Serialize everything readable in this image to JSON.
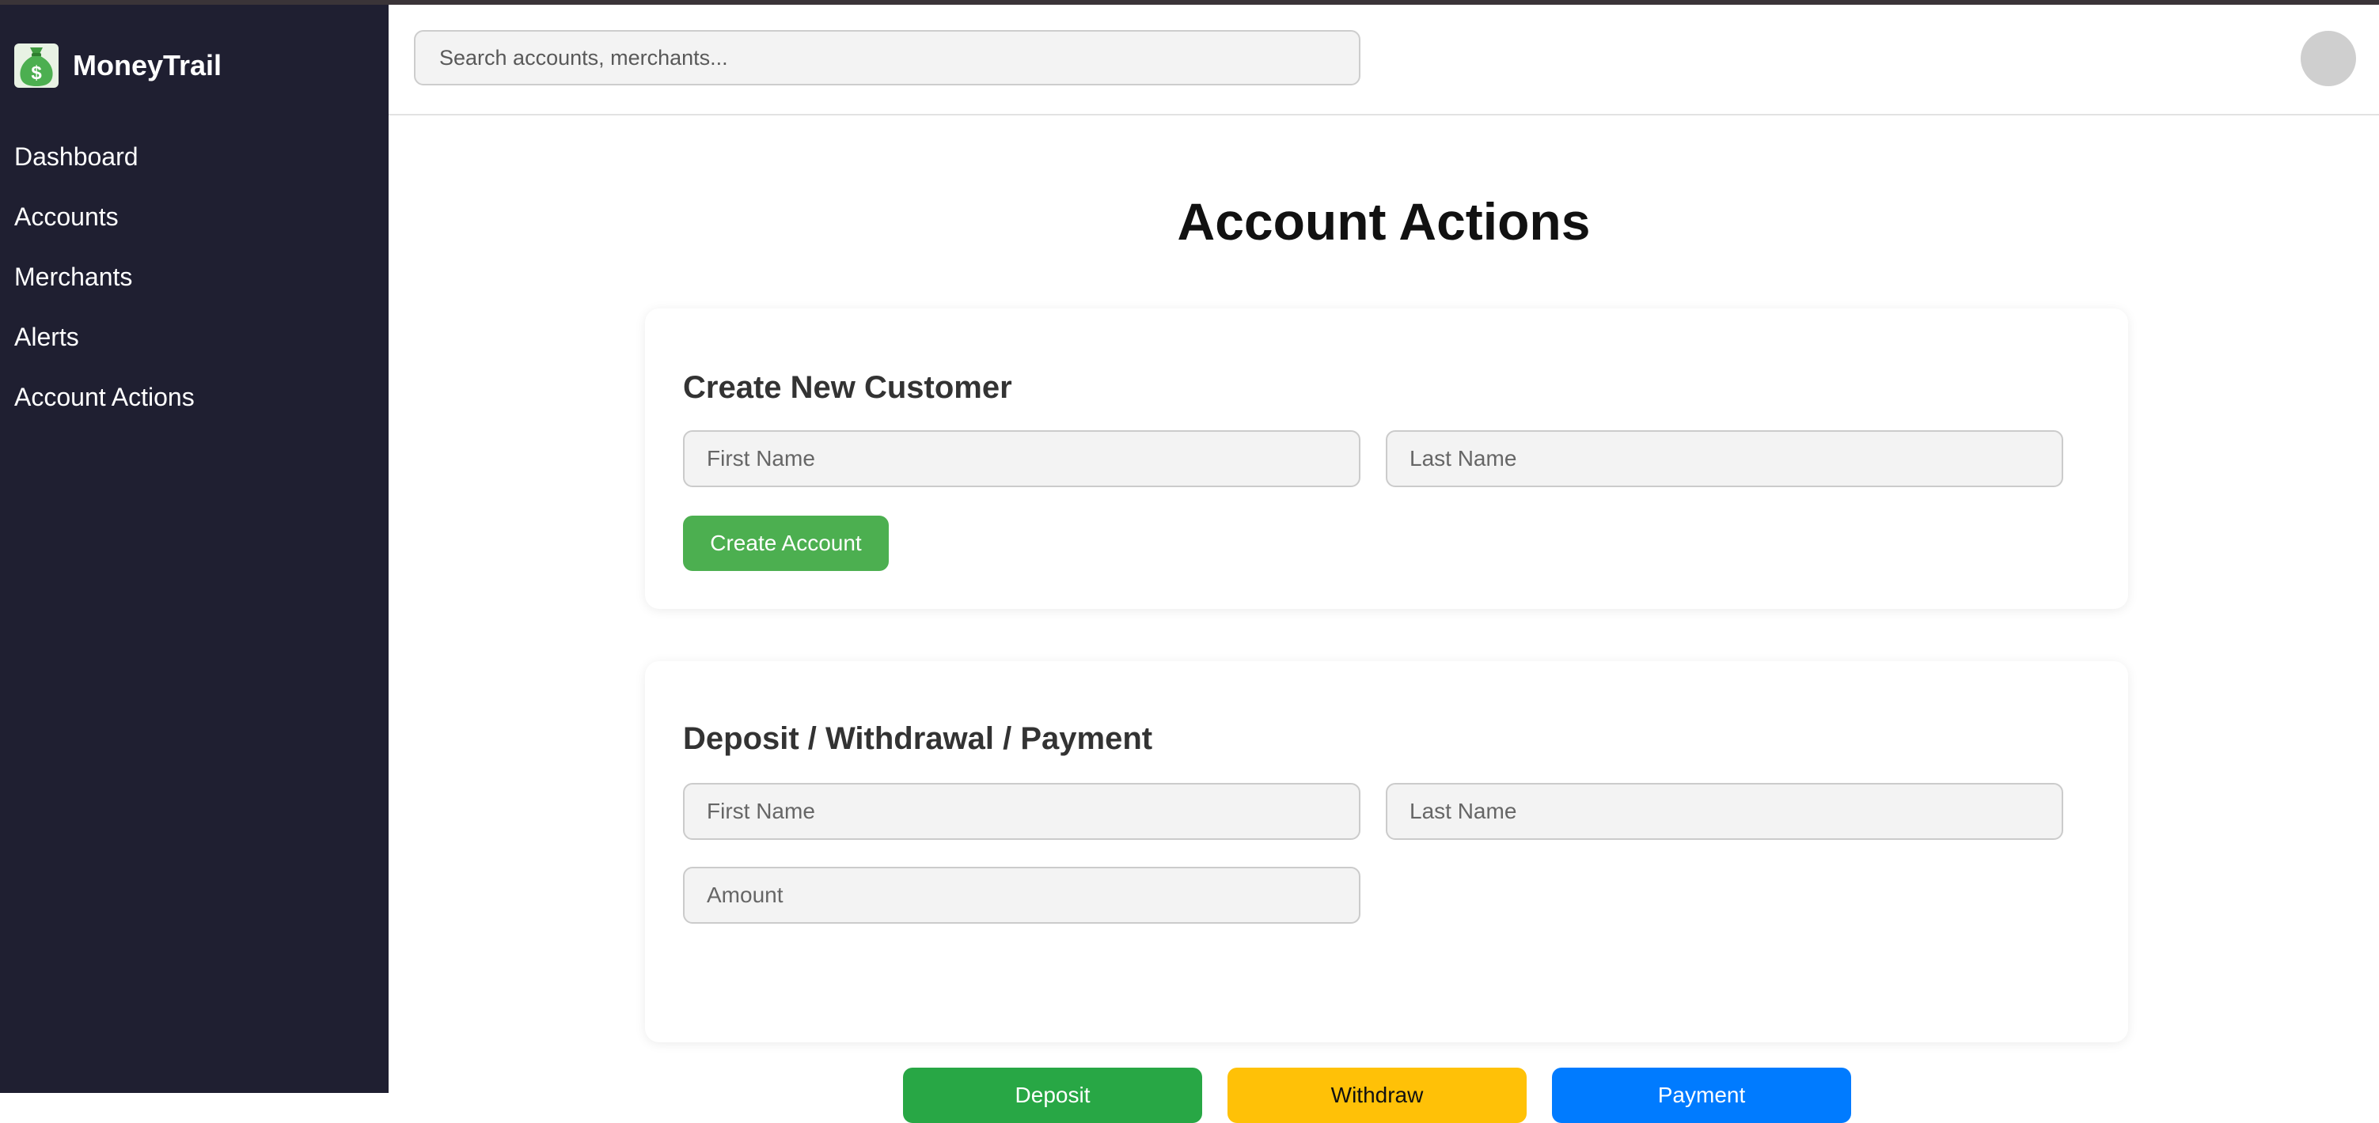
{
  "app": {
    "name": "MoneyTrail",
    "logo_icon": "money-bag-icon",
    "accent_color": "#28a745"
  },
  "sidebar": {
    "items": [
      {
        "label": "Dashboard"
      },
      {
        "label": "Accounts"
      },
      {
        "label": "Merchants"
      },
      {
        "label": "Alerts"
      },
      {
        "label": "Account Actions"
      }
    ]
  },
  "header": {
    "search_placeholder": "Search accounts, merchants..."
  },
  "main": {
    "title": "Account Actions",
    "create_customer": {
      "title": "Create New Customer",
      "first_name_placeholder": "First Name",
      "last_name_placeholder": "Last Name",
      "submit_label": "Create Account",
      "submit_color": "#4caf50"
    },
    "transaction": {
      "title": "Deposit / Withdrawal / Payment",
      "first_name_placeholder": "First Name",
      "last_name_placeholder": "Last Name",
      "amount_placeholder": "Amount",
      "deposit_label": "Deposit",
      "deposit_color": "#28a745",
      "withdraw_label": "Withdraw",
      "withdraw_color": "#ffc107",
      "payment_label": "Payment",
      "payment_color": "#007bff"
    }
  }
}
